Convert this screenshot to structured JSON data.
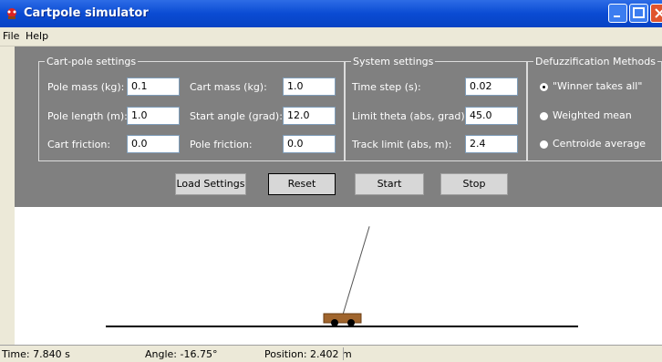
{
  "window": {
    "title": "Cartpole simulator"
  },
  "menu": [
    "File",
    "Help"
  ],
  "cartpole": {
    "legend": "Cart-pole settings",
    "pole_mass_label": "Pole mass (kg):",
    "pole_mass": "0.1",
    "pole_length_label": "Pole length (m):",
    "pole_length": "1.0",
    "cart_friction_label": "Cart friction:",
    "cart_friction": "0.0",
    "cart_mass_label": "Cart mass (kg):",
    "cart_mass": "1.0",
    "start_angle_label": "Start angle (grad):",
    "start_angle": "12.0",
    "pole_friction_label": "Pole friction:",
    "pole_friction": "0.0"
  },
  "system": {
    "legend": "System settings",
    "time_step_label": "Time step (s):",
    "time_step": "0.02",
    "limit_theta_label": "Limit theta (abs, grad):",
    "limit_theta": "45.0",
    "track_limit_label": "Track limit (abs, m):",
    "track_limit": "2.4"
  },
  "defuzz": {
    "legend": "Defuzzification Methods",
    "options": [
      "\"Winner takes all\"",
      "Weighted mean",
      "Centroide average"
    ],
    "selected": 0
  },
  "buttons": {
    "load": "Load Settings",
    "reset": "Reset",
    "start": "Start",
    "stop": "Stop"
  },
  "simulation": {
    "pole_angle_deg": -16.75
  },
  "status": {
    "time": "Time: 7.840 s",
    "angle": "Angle: -16.75°",
    "position": "Position: 2.402 m"
  },
  "colors": {
    "titlebar": "#0A4BD3",
    "panel": "#808080",
    "cart": "#A0652D",
    "track": "#000000"
  }
}
